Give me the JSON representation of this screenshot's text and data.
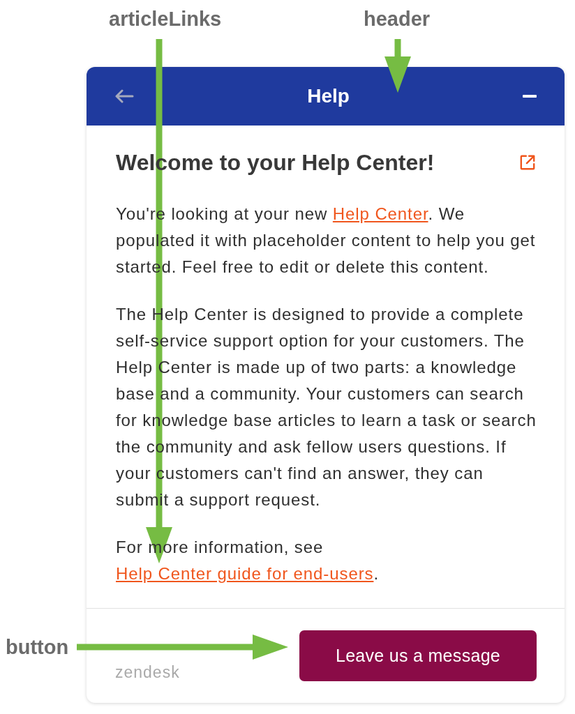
{
  "annotations": [
    {
      "label": "articleLinks",
      "kind": "down"
    },
    {
      "label": "header",
      "kind": "down"
    },
    {
      "label": "button",
      "kind": "right"
    }
  ],
  "widget": {
    "header": {
      "title": "Help",
      "back_disabled": true
    },
    "article": {
      "title": "Welcome to your Help Center!",
      "paragraphs": [
        [
          {
            "kind": "text",
            "text": "You're looking at your new "
          },
          {
            "kind": "link",
            "text": "Help Center"
          },
          {
            "kind": "text",
            "text": ". We populated it with placeholder content to help you get started. Feel free to edit or delete this content."
          }
        ],
        [
          {
            "kind": "text",
            "text": "The Help Center is designed to provide a complete self-service support option for your customers. The Help Center is made up of two parts: a knowledge base and a community. Your customers can search for knowledge base articles to learn a task or search the community and ask fellow users questions. If your customers can't find an answer, they can submit a support request."
          }
        ],
        [
          {
            "kind": "text",
            "text": "For more information, see "
          },
          {
            "kind": "link",
            "text": "Help Center guide for end-users"
          },
          {
            "kind": "text",
            "text": "."
          }
        ]
      ]
    },
    "footer": {
      "brand": "zendesk",
      "button": "Leave us a message"
    }
  }
}
